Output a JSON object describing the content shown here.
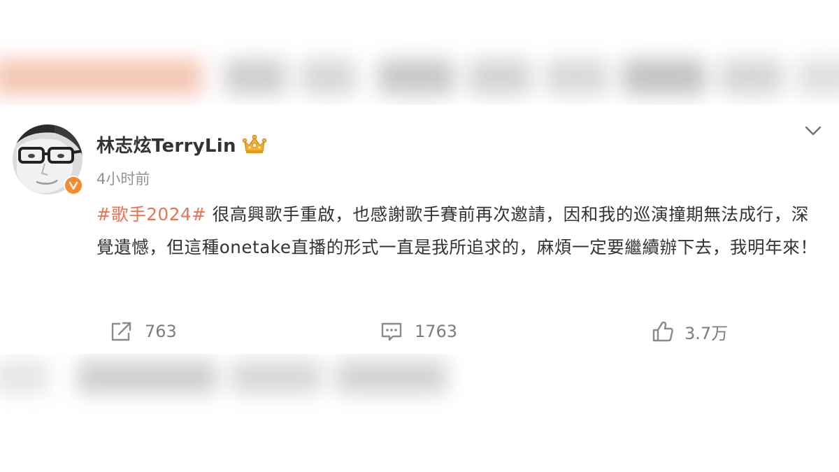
{
  "post": {
    "author": "林志炫TerryLin",
    "timestamp": "4小时前",
    "hashtag": "#歌手2024#",
    "body": " 很高興歌手重啟，也感謝歌手賽前再次邀請，因和我的巡演撞期無法成行，深覺遺憾，但這種onetake直播的形式一直是我所追求的，麻煩一定要繼續辦下去，我明年來！",
    "badges": {
      "verified_icon": "verified-v-icon",
      "level_icon": "crown-icon"
    }
  },
  "actions": {
    "repost": {
      "icon": "repost-icon",
      "count": "763"
    },
    "comment": {
      "icon": "comment-icon",
      "count": "1763"
    },
    "like": {
      "icon": "thumbs-up-icon",
      "count": "3.7万"
    }
  },
  "menu": {
    "icon": "chevron-down-icon"
  },
  "colors": {
    "hashtag": "#eb7350",
    "verified_badge": "#f78a2c",
    "text": "#333333",
    "meta": "#939393"
  }
}
